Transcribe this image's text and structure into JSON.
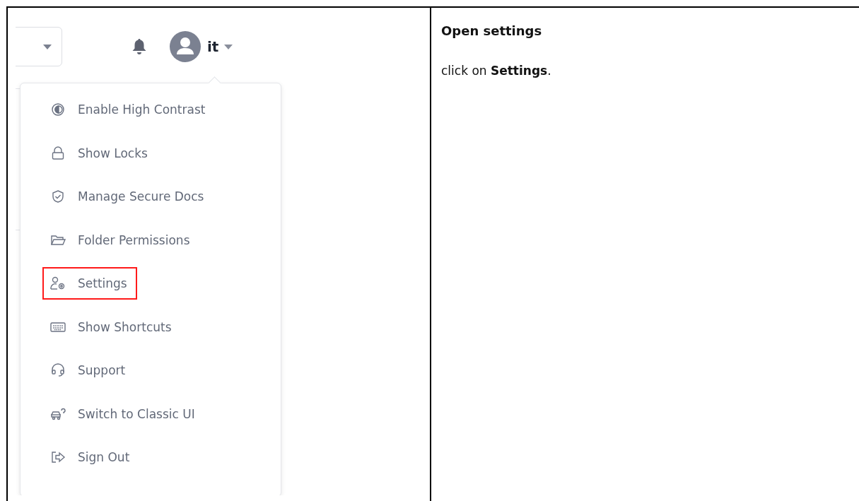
{
  "screenshot": {
    "user": {
      "name": "it"
    },
    "menu": [
      {
        "kind": "contrast",
        "label": "Enable High Contrast",
        "highlighted": false
      },
      {
        "kind": "lock",
        "label": "Show Locks",
        "highlighted": false
      },
      {
        "kind": "shield",
        "label": "Manage Secure Docs",
        "highlighted": false
      },
      {
        "kind": "folder",
        "label": "Folder Permissions",
        "highlighted": false
      },
      {
        "kind": "user-gear",
        "label": "Settings",
        "highlighted": true
      },
      {
        "kind": "keyboard",
        "label": "Show Shortcuts",
        "highlighted": false
      },
      {
        "kind": "headset",
        "label": "Support",
        "highlighted": false
      },
      {
        "kind": "car",
        "label": "Switch to Classic UI",
        "highlighted": false
      },
      {
        "kind": "sign-out",
        "label": "Sign Out",
        "highlighted": false
      }
    ]
  },
  "step": {
    "title": "Open settings",
    "text": "click on **Settings**."
  }
}
